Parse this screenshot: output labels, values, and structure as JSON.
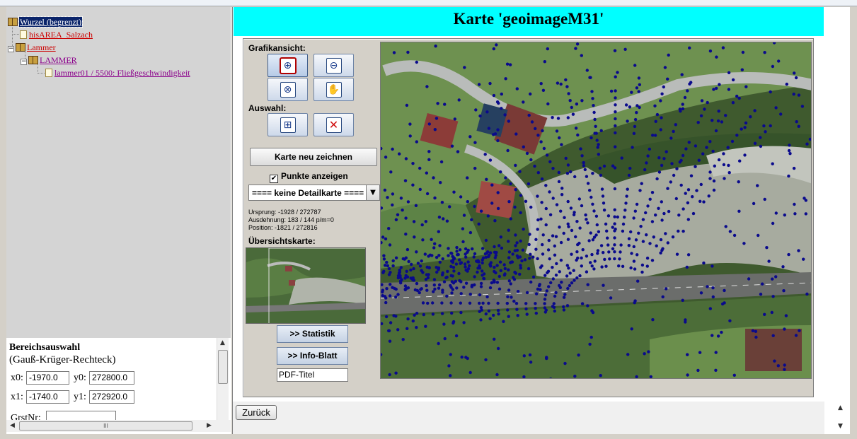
{
  "tree": {
    "items": [
      {
        "label": "Wurzel (begrenzt)",
        "icon": "book-icon",
        "expander": ""
      },
      {
        "label": "hisAREA_Salzach",
        "icon": "document-icon",
        "expander": ""
      },
      {
        "label": "Lammer",
        "icon": "book-icon",
        "expander": "−"
      },
      {
        "label": "LAMMER",
        "icon": "book-icon",
        "expander": "−"
      },
      {
        "label": "lammer01 / 5500: Fließgeschwindigkeit",
        "icon": "document-icon",
        "expander": ""
      }
    ]
  },
  "form": {
    "title": "Bereichsauswahl",
    "subtitle": "(Gauß-Krüger-Rechteck)",
    "x0_label": "x0:",
    "x0_value": "-1970.0",
    "y0_label": "y0:",
    "y0_value": "272800.0",
    "x1_label": "x1:",
    "x1_value": "-1740.0",
    "y1_label": "y1:",
    "y1_value": "272920.0",
    "grst_label": "GrstNr:",
    "grst_value": "",
    "hscroll_grip": "III"
  },
  "main": {
    "title": "Karte 'geoimageM31'",
    "grafikansicht_label": "Grafikansicht:",
    "auswahl_label": "Auswahl:",
    "tools": [
      "zoom-in-icon",
      "zoom-out-icon",
      "zoom-full-icon",
      "pan-hand-icon",
      "select-binoculars-icon",
      "clear-selection-icon"
    ],
    "redraw_label": "Karte neu zeichnen",
    "points_checkbox_label": "Punkte anzeigen",
    "points_checked": true,
    "checkmark": "✔",
    "detail_select_value": "==== keine Detailkarte ====",
    "ursprung": "Ursprung: -1928 / 272787",
    "ausdehnung": "Ausdehnung: 183 / 144 p/m=0",
    "position": "Position: -1821 / 272816",
    "overview_label": "Übersichtskarte:",
    "statistik_label": ">> Statistik",
    "infoblatt_label": ">> Info-Blatt",
    "pdf_title_value": "PDF-Titel"
  },
  "bottom": {
    "back_label": "Zurück"
  },
  "colors": {
    "title_bg": "#00ffff",
    "link_red": "#cc0000",
    "point_blue": "#0a0a8c",
    "tree_selected_bg": "#0a246a"
  }
}
